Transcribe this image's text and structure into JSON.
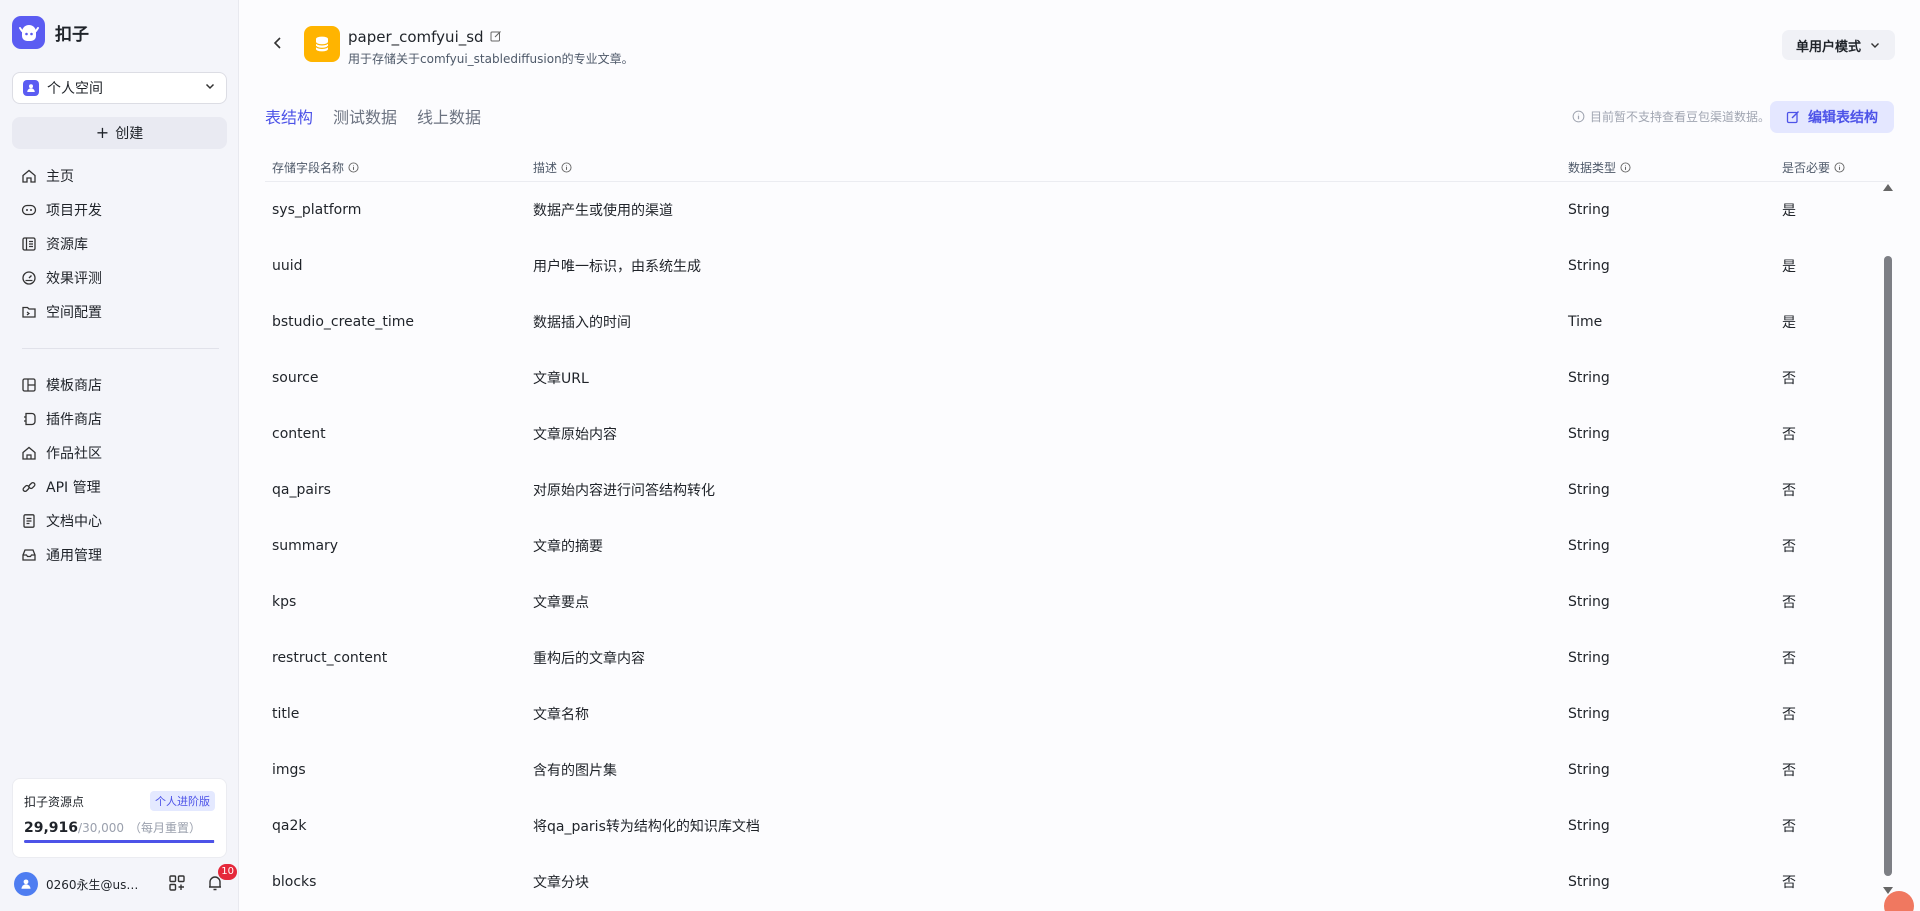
{
  "brand": {
    "name": "扣子"
  },
  "sidebar": {
    "space_label": "个人空间",
    "create_label": "创建",
    "nav_primary": [
      {
        "label": "主页",
        "icon": "home-icon"
      },
      {
        "label": "项目开发",
        "icon": "bot-icon"
      },
      {
        "label": "资源库",
        "icon": "library-icon"
      },
      {
        "label": "效果评测",
        "icon": "gauge-icon"
      },
      {
        "label": "空间配置",
        "icon": "folder-settings-icon"
      }
    ],
    "nav_secondary": [
      {
        "label": "模板商店",
        "icon": "template-icon"
      },
      {
        "label": "插件商店",
        "icon": "plugin-icon"
      },
      {
        "label": "作品社区",
        "icon": "community-icon"
      },
      {
        "label": "API 管理",
        "icon": "link-icon"
      },
      {
        "label": "文档中心",
        "icon": "doc-icon"
      },
      {
        "label": "通用管理",
        "icon": "inbox-icon"
      }
    ],
    "quota": {
      "title": "扣子资源点",
      "badge": "个人进阶版",
      "used": "29,916",
      "total": "/30,000",
      "reset": "（每月重置）",
      "fraction": 0.9972
    },
    "user": {
      "name": "0260永生@us…",
      "notifications": "10"
    }
  },
  "header": {
    "title": "paper_comfyui_sd",
    "subtitle": "用于存储关于comfyui_stablediffusion的专业文章。",
    "mode_label": "单用户模式"
  },
  "tabs": [
    {
      "label": "表结构",
      "active": true
    },
    {
      "label": "测试数据",
      "active": false
    },
    {
      "label": "线上数据",
      "active": false
    }
  ],
  "notice": "目前暂不支持查看豆包渠道数据。",
  "edit_label": "编辑表结构",
  "table": {
    "columns": [
      "存储字段名称",
      "描述",
      "数据类型",
      "是否必要"
    ],
    "rows": [
      [
        "sys_platform",
        "数据产生或使用的渠道",
        "String",
        "是"
      ],
      [
        "uuid",
        "用户唯一标识，由系统生成",
        "String",
        "是"
      ],
      [
        "bstudio_create_time",
        "数据插入的时间",
        "Time",
        "是"
      ],
      [
        "source",
        "文章URL",
        "String",
        "否"
      ],
      [
        "content",
        "文章原始内容",
        "String",
        "否"
      ],
      [
        "qa_pairs",
        "对原始内容进行问答结构转化",
        "String",
        "否"
      ],
      [
        "summary",
        "文章的摘要",
        "String",
        "否"
      ],
      [
        "kps",
        "文章要点",
        "String",
        "否"
      ],
      [
        "restruct_content",
        "重构后的文章内容",
        "String",
        "否"
      ],
      [
        "title",
        "文章名称",
        "String",
        "否"
      ],
      [
        "imgs",
        "含有的图片集",
        "String",
        "否"
      ],
      [
        "qa2k",
        "将qa_paris转为结构化的知识库文档",
        "String",
        "否"
      ],
      [
        "blocks",
        "文章分块",
        "String",
        "否"
      ]
    ]
  }
}
